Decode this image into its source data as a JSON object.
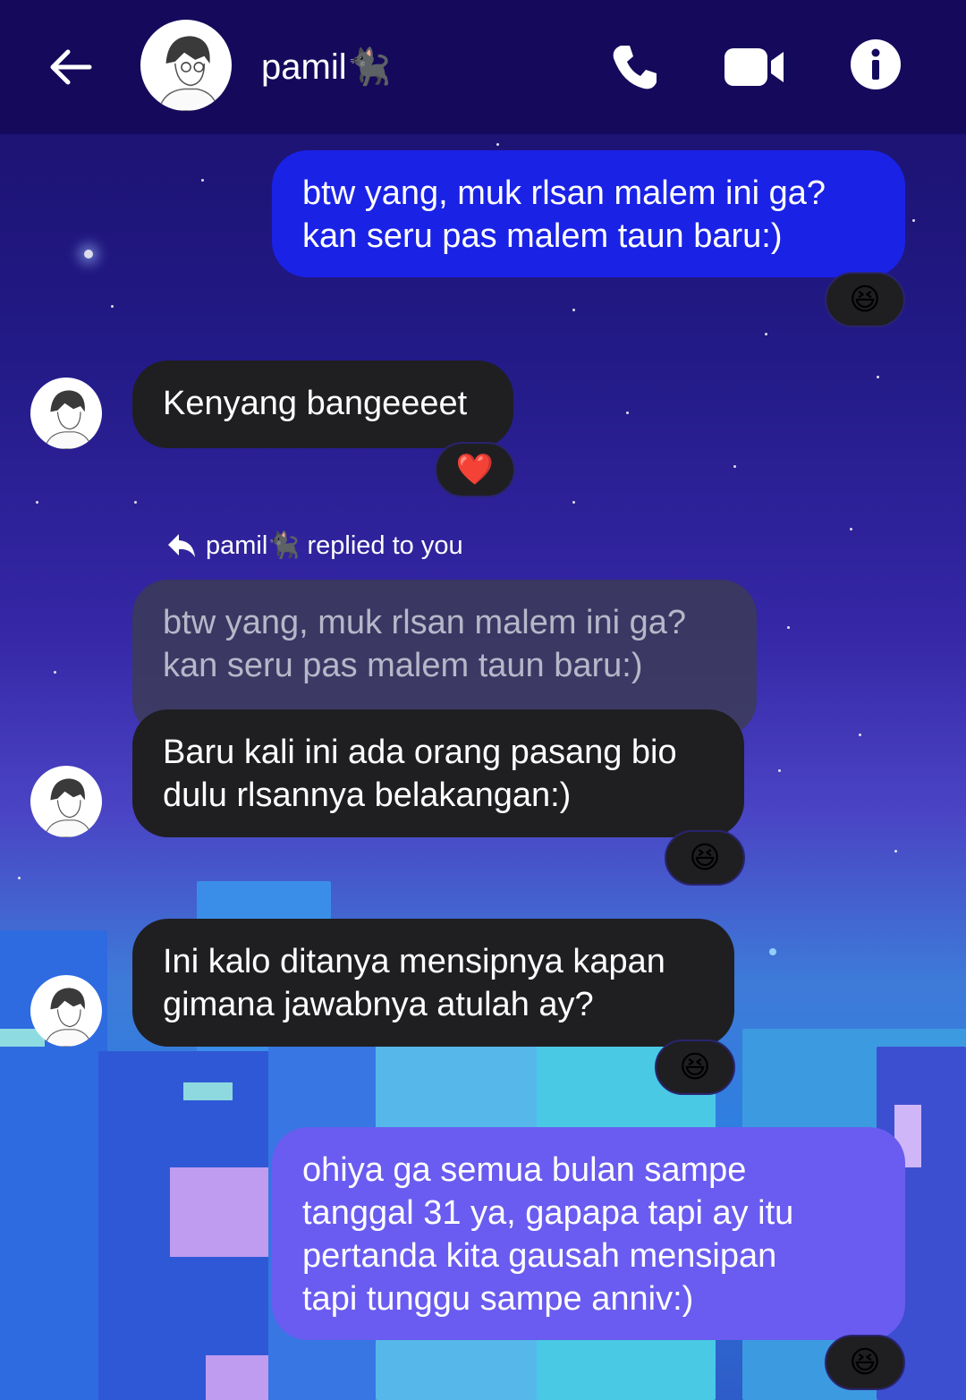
{
  "header": {
    "contact_name": "pamil🐈‍⬛"
  },
  "messages": [
    {
      "id": "m1",
      "direction": "outgoing",
      "text": "btw yang, muk rlsan malem ini ga?\nkan seru pas malem taun baru:)",
      "reaction": "😆"
    },
    {
      "id": "m2",
      "direction": "incoming",
      "text": "Kenyang bangeeeet",
      "reaction": "❤️"
    },
    {
      "id": "m3",
      "direction": "incoming",
      "reply_label": "pamil🐈‍⬛ replied to you",
      "quoted_text": "btw yang, muk rlsan malem ini ga?\nkan seru pas malem taun baru:)",
      "text": "Baru kali ini ada orang pasang bio\ndulu rlsannya belakangan:)",
      "reaction": "😆"
    },
    {
      "id": "m4",
      "direction": "incoming",
      "text": "Ini kalo ditanya mensipnya kapan\ngimana jawabnya atulah ay?",
      "reaction": "😆"
    },
    {
      "id": "m5",
      "direction": "outgoing",
      "text": "ohiya ga semua bulan sampe\ntanggal 31 ya, gapapa tapi ay itu\npertanda kita gausah mensipan\ntapi tunggu sampe anniv:)",
      "reaction": "😆"
    }
  ],
  "icons": {
    "back": "arrow-left-icon",
    "call": "phone-icon",
    "video": "video-camera-icon",
    "info": "info-icon",
    "reply": "reply-arrow-icon"
  },
  "colors": {
    "header_bg": "#15095c",
    "outgoing_bubble": "#1a22e6",
    "incoming_bubble": "#1f1f22",
    "outgoing_bubble_lower": "#6a5cf0"
  }
}
